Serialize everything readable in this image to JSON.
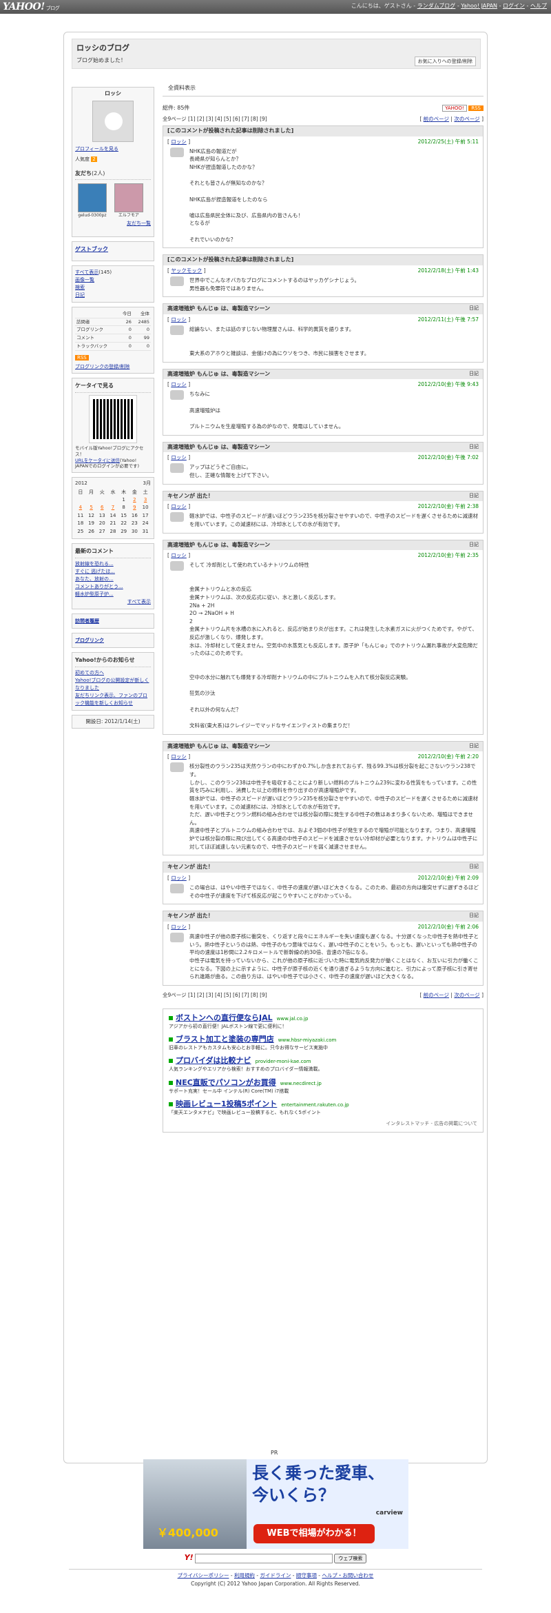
{
  "topbar": {
    "logo": "YAHOO!",
    "logo_sub": "ブログ",
    "greeting": "こんにちは、ゲストさん",
    "links": [
      "ランダムブログ",
      "Yahoo! JAPAN",
      "ログイン",
      "ヘルプ"
    ]
  },
  "blog": {
    "title": "ロッシのブログ",
    "description": "ブログ始めました！",
    "fav_button": "お気に入りへの登録/削除"
  },
  "profile": {
    "name": "ロッシ",
    "link": "プロフィールを見る",
    "popularity": "人気度",
    "pop_value": "2"
  },
  "friends": {
    "heading": "友だち",
    "count": "(2人)",
    "items": [
      {
        "name": "gelud-0300pz"
      },
      {
        "name": "エルフモア"
      }
    ],
    "more": "友だち一覧"
  },
  "guestbook": "ゲストブック",
  "menu": {
    "all": "すべて表示",
    "all_count": "(145)",
    "images": "画像一覧",
    "search": "検索",
    "diary": "日記"
  },
  "stats": {
    "header": [
      "今日",
      "全体"
    ],
    "rows": [
      {
        "label": "訪問者",
        "today": "26",
        "total": "2485"
      },
      {
        "label": "ブログリンク",
        "today": "0",
        "total": "0"
      },
      {
        "label": "コメント",
        "today": "0",
        "total": "99"
      },
      {
        "label": "トラックバック",
        "today": "0",
        "total": "0"
      }
    ],
    "rss": "RSS",
    "link_btn": "ブログリンクの登録/削除"
  },
  "mobile": {
    "heading": "ケータイで見る",
    "desc": "モバイル版Yahoo!ブログにアクセス！",
    "url_send": "URLをケータイに送信",
    "note": "(Yahoo! JAPANでのログインが必要です)"
  },
  "calendar": {
    "year": "2012",
    "month": "3月",
    "days": [
      "日",
      "月",
      "火",
      "水",
      "木",
      "金",
      "土"
    ],
    "weeks": [
      [
        "",
        "",
        "",
        "",
        "1",
        "2",
        "3"
      ],
      [
        "4",
        "5",
        "6",
        "7",
        "8",
        "9",
        "10"
      ],
      [
        "11",
        "12",
        "13",
        "14",
        "15",
        "16",
        "17"
      ],
      [
        "18",
        "19",
        "20",
        "21",
        "22",
        "23",
        "24"
      ],
      [
        "25",
        "26",
        "27",
        "28",
        "29",
        "30",
        "31"
      ]
    ]
  },
  "recent": {
    "heading": "最新のコメント",
    "items": [
      "放射線を恐れる...",
      "すぐに 逃げたほ...",
      "あなた、放射の...",
      "コメントありがとう...",
      "軽水炉型原子炉..."
    ],
    "more": "すべて表示"
  },
  "side_links": {
    "history": "訪問者履歴",
    "bloglink": "ブログリンク"
  },
  "notice": {
    "heading": "Yahoo!からのお知らせ",
    "items": [
      "初めての方へ",
      "Yahoo!ブログの公開設定が新しくなりました",
      "友だちリンク表示、ファンのブロック機能を新しくお知らせ"
    ]
  },
  "opened": "開設日: 2012/1/14(土)",
  "main": {
    "tab": "全資料表示",
    "count": "総件: 85件",
    "rss": "RSS",
    "yahoo": "YAHOO!",
    "pager": "全9ページ [1] [2] [3] [4] [5] [6] [7] [8] [9]",
    "prev": "前のページ",
    "next": "次のページ"
  },
  "entries": [
    {
      "title": "[このコメントが投稿された記事は削除されました]",
      "category": "",
      "author": "ロッシ",
      "date": "2012/2/25(土) 午前 5:11",
      "body": "NHK広島の報道だが\n長崎県が知らんとか？\nNHKが捏造報道したのかな？\n\nそれとも皆さんが無知なのかな？\n\nNHK広島が捏造報道をしたのなら\n\n嘘は広島県民全体に及び、広島県内の皆さんも！\nとなるが\n\nそれでいいのかな？"
    },
    {
      "title": "[このコメントが投稿された記事は削除されました]",
      "category": "",
      "author": "ヤックモック",
      "date": "2012/2/18(土) 午前 1:43",
      "body": "世界中でこんなオバカなブログにコメントするのはヤッカゲシナじょう。\n男性器も免罪符ではありません。"
    },
    {
      "title": "高速増殖炉 もんじゅ は、毒製造マシーン",
      "category": "日記",
      "author": "ロッシ",
      "date": "2012/2/11(土) 午後 7:57",
      "body": "総論ない、または話のすじない物理屋さんは、科学的異質を語ります。\n\n\n東大系のアホウと雑談は、金儲けの為にウソをつき、市民に損害をさせます。"
    },
    {
      "title": "高速増殖炉 もんじゅ は、毒製造マシーン",
      "category": "日記",
      "author": "ロッシ",
      "date": "2012/2/10(金) 午後 9:43",
      "body": "ちなみに\n\n高速増殖炉は\n\nプルトニウムを生産増殖する為の炉なので、発電はしていません。"
    },
    {
      "title": "高速増殖炉 もんじゅ は、毒製造マシーン",
      "category": "日記",
      "author": "ロッシ",
      "date": "2012/2/10(金) 午後 7:02",
      "body": "アップはどうぞご自由に。\n但し、正確な情報を上げて下さい。"
    },
    {
      "title": "キセノンが 出た！",
      "category": "日記",
      "author": "ロッシ",
      "date": "2012/2/10(金) 午前 2:38",
      "body": "軽水炉では、中性子のスピードが速いほどウラン235を核分裂させやすいので、中性子のスピードを遅くさせるために減速材を用いています。この減速材には、冷却水としての水が有効です。"
    },
    {
      "title": "高速増殖炉 もんじゅ は、毒製造マシーン",
      "category": "日記",
      "author": "ロッシ",
      "date": "2012/2/10(金) 午前 2:35",
      "body": "そして 冷却剤として使われているナトリウムの特性\n\n\n金属ナトリウムと水の反応\n金属ナトリウムは、次の反応式に従い、水と激しく反応します。\n2Na + 2H\n2O → 2NaOH + H\n2\n金属ナトリウム片を水槽の水に入れると、反応が始まり炎が出ます。これは発生した水素ガスに火がつくためです。やがて、反応が激しくなり、爆発します。\n水は、冷却材として使えません。空気中の水蒸気とも反応します。原子炉「もんじゅ」でのナトリウム漏れ事故が大変危険だったのはこのためです。\n\n\n空中の水分に触れても爆発する冷却剤ナトリウムの中にプルトニウムを入れて核分裂反応実験。\n\n狂気の沙汰\n\nそれ以外の何なんだ？\n\n文科省(東大系)はクレイジーでマッドなサイエンティストの集まりだ！"
    },
    {
      "title": "高速増殖炉 もんじゅ は、毒製造マシーン",
      "category": "日記",
      "author": "ロッシ",
      "date": "2012/2/10(金) 午前 2:20",
      "body": "核分裂性のウラン235は天然ウランの中にわずか0.7%しか含まれておらず、残る99.3%は核分裂を起こさないウラン238です。\nしかし、このウラン238は中性子を吸収することにより新しい燃料のプルトニウム239に変わる性質をもっています。この性質を巧みに利用し、消費した以上の燃料を作り出すのが高速増殖炉です。\n軽水炉では、中性子のスピードが遅いほどウラン235を核分裂させやすいので、中性子のスピードを遅くさせるために減速材を用いています。この減速材には、冷却水としての水が有効です。\nただ、遅い中性子とウラン燃料の組み合わせでは核分裂の際に発生する中性子の数はあまり多くないため、増殖はできません。\n高速中性子とプルトニウムの組み合わせでは、およそ3個の中性子が発生するので増殖が可能となります。つまり、高速増殖炉では核分裂の際に飛び出してくる高速の中性子のスピードを減速させない冷却材が必要となります。ナトリウムは中性子に対してほぼ減速しない元素なので、中性子のスピードを弱く減速させません。"
    },
    {
      "title": "キセノンが 出た！",
      "category": "日記",
      "author": "ロッシ",
      "date": "2012/2/10(金) 午前 2:09",
      "body": "この場合は、はやい中性子ではなく、中性子の速度が遅いほど大きくなる。このため、最初の方向は衝突せずに遅ずきるほどその中性子が速度を下げて核反応が起こりやすいことがわかっている。"
    },
    {
      "title": "キセノンが 出た！",
      "category": "日記",
      "author": "ロッシ",
      "date": "2012/2/10(金) 午前 2:06",
      "body": "高速中性子が他の原子核に衝突を、くり返すと段々にエネルギーを失い速度も遅くなる。十分遅くなった中性子を熱中性子という。熱中性子というのは熱、中性子のもつ意味ではなく、遅い中性子のことをいう。もっとも、遅いといっても熱中性子の平均の速度は1秒間に2.2キロメートルで新幹線の約30倍、音速の7倍になる。\n中性子は電気を持っていないから、これが他の原子核に近づいた時に電気的反発力が働くことはなく、お互いに引力が働くことになる。下図の上に示すように、中性子が原子核の近くを通り過ぎるような方向に進むと、引力によって原子核に引き寄せられ進路が曲る。この曲り方は、はやい中性子では小さく、中性子の速度が遅いほど大きくなる。"
    }
  ],
  "ads": [
    {
      "title": "ボストンへの直行便ならJAL",
      "url": "www.jal.co.jp",
      "desc": "アジアから初の直行便！JALボストン線で更に便利に！"
    },
    {
      "title": "ブラスト加工と塗装の専門店",
      "url": "www.hbsr-miyazaki.com",
      "desc": "旧車のレストアもカスタムも安心とお手軽に。只今お得なサービス実施中"
    },
    {
      "title": "プロバイダは比較ナビ",
      "url": "provider-moni-kae.com",
      "desc": "人気ランキングやエリアから検索！おすすめのプロバイダー情報満載。"
    },
    {
      "title": "NEC直販でパソコンがお買得",
      "url": "www.necdirect.jp",
      "desc": "サポート充実！セール中 インテル(R) Core(TM) i7搭載"
    },
    {
      "title": "映画レビュー1投稿5ポイント",
      "url": "entertainment.rakuten.co.jp",
      "desc": "「楽天エンタメナビ」で映画レビュー投稿すると、もれなく5ポイント"
    }
  ],
  "ads_footer": "インタレストマッチ - 広告の掲載について",
  "banner": {
    "pr": "PR",
    "line1": "長く乗った愛車、",
    "line2": "今いくら？",
    "price": "￥400,000",
    "cta": "WEBで相場がわかる！",
    "brand": "carview"
  },
  "search": {
    "button": "ウェブ検索"
  },
  "footer": {
    "links": [
      "プライバシーポリシー",
      "利用規約",
      "ガイドライン",
      "順守事項",
      "ヘルプ・お問い合わせ"
    ],
    "copyright": "Copyright (C) 2012 Yahoo Japan Corporation. All Rights Reserved."
  }
}
